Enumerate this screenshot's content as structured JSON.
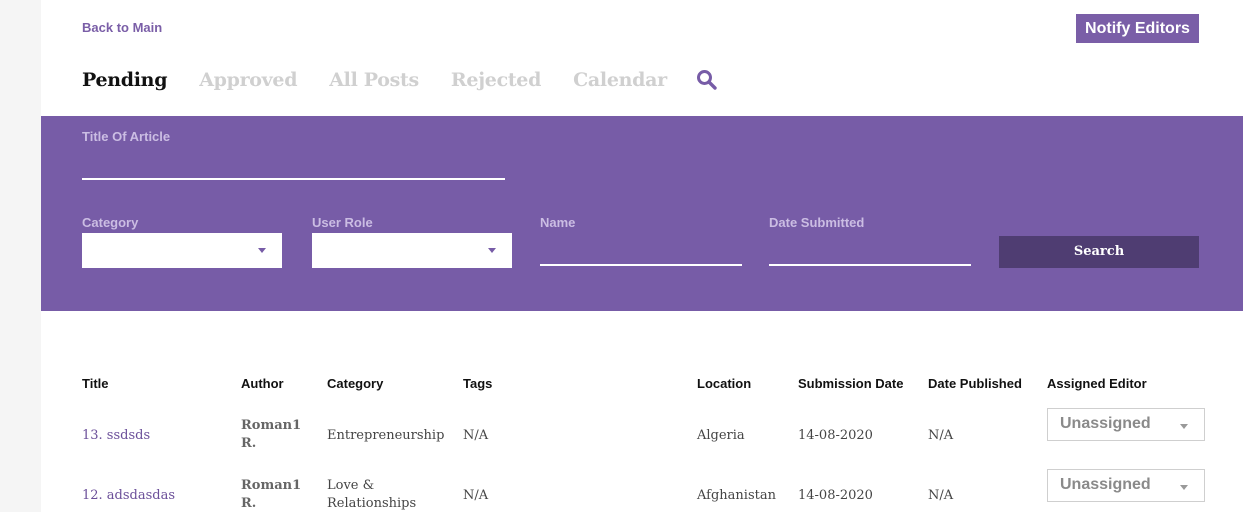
{
  "header": {
    "back_link": "Back to Main",
    "notify_button": "Notify Editors"
  },
  "tabs": [
    {
      "label": "Pending",
      "active": true
    },
    {
      "label": "Approved",
      "active": false
    },
    {
      "label": "All Posts",
      "active": false
    },
    {
      "label": "Rejected",
      "active": false
    },
    {
      "label": "Calendar",
      "active": false
    }
  ],
  "search_icon": "search-icon",
  "filters": {
    "title_label": "Title Of Article",
    "title_value": "",
    "category_label": "Category",
    "category_value": "",
    "user_role_label": "User Role",
    "user_role_value": "",
    "name_label": "Name",
    "name_value": "",
    "date_label": "Date Submitted",
    "date_value": "",
    "search_button": "Search"
  },
  "table": {
    "headers": [
      "Title",
      "Author",
      "Category",
      "Tags",
      "Location",
      "Submission Date",
      "Date Published",
      "Assigned Editor"
    ],
    "rows": [
      {
        "title": "13. ssdsds",
        "author_line1": "Roman1",
        "author_line2": "R.",
        "category_line1": "Entrepreneurship",
        "category_line2": "",
        "tags": "N/A",
        "location": "Algeria",
        "submission_date": "14-08-2020",
        "date_published": "N/A",
        "editor": "Unassigned"
      },
      {
        "title": "12. adsdasdas",
        "author_line1": "Roman1",
        "author_line2": "R.",
        "category_line1": "Love &",
        "category_line2": "Relationships",
        "tags": "N/A",
        "location": "Afghanistan",
        "submission_date": "14-08-2020",
        "date_published": "N/A",
        "editor": "Unassigned"
      }
    ]
  },
  "colors": {
    "brand_purple": "#775ca7",
    "dark_purple": "#4f3d72",
    "link_purple": "#6b4f99"
  }
}
